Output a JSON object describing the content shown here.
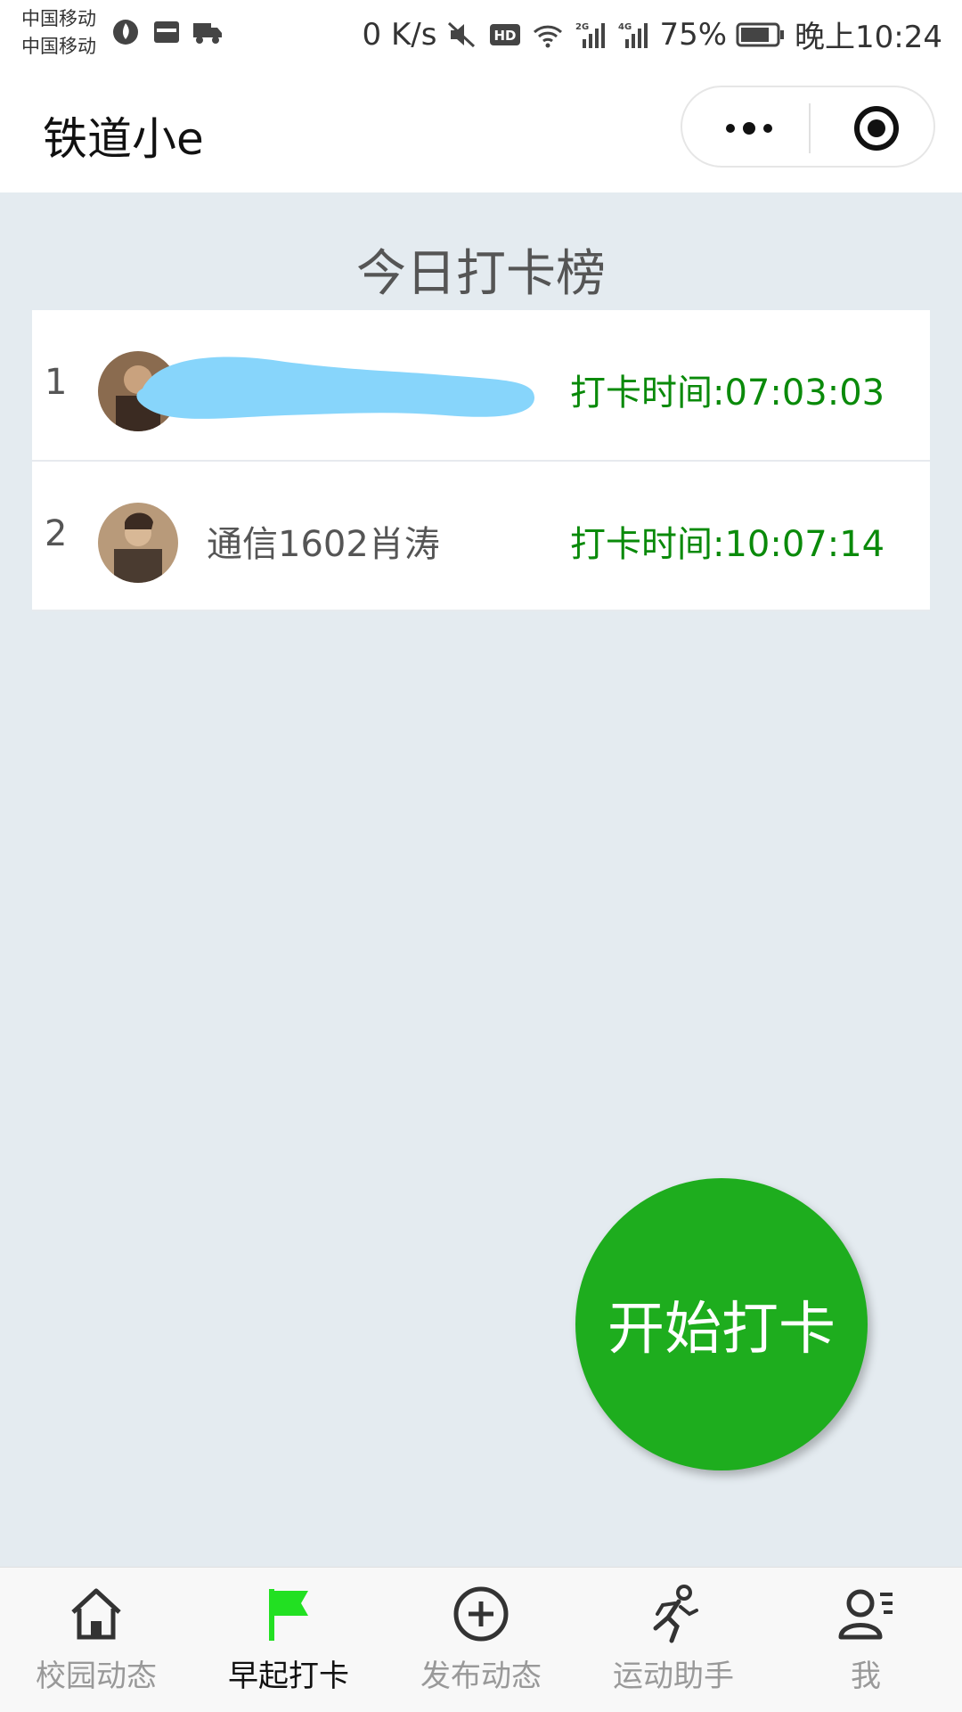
{
  "status_bar": {
    "carrier_1": "中国移动",
    "carrier_2": "中国移动",
    "net_speed": "0 K/s",
    "battery": "75%",
    "time": "晚上10:24",
    "icons": [
      "flame-icon",
      "calendar-icon",
      "truck-icon",
      "mute-icon",
      "hd-icon",
      "wifi-icon",
      "signal-2g-icon",
      "signal-4g-icon",
      "battery-icon"
    ]
  },
  "nav": {
    "title": "铁道小e",
    "more_icon": "more-icon",
    "close_icon": "target-icon"
  },
  "board": {
    "title": "今日打卡榜",
    "entries": [
      {
        "rank": "1",
        "name": "",
        "time": "打卡时间:07:03:03"
      },
      {
        "rank": "2",
        "name": "通信1602肖涛",
        "time": "打卡时间:10:07:14"
      }
    ]
  },
  "action": {
    "checkin_label": "开始打卡",
    "color": "#1ead1e"
  },
  "tabbar": {
    "active_color": "#22e022",
    "tabs": [
      {
        "label": "校园动态",
        "icon": "home-icon",
        "active": false
      },
      {
        "label": "早起打卡",
        "icon": "flag-icon",
        "active": true
      },
      {
        "label": "发布动态",
        "icon": "plus-circle-icon",
        "active": false
      },
      {
        "label": "运动助手",
        "icon": "runner-icon",
        "active": false
      },
      {
        "label": "我",
        "icon": "user-icon",
        "active": false
      }
    ]
  }
}
